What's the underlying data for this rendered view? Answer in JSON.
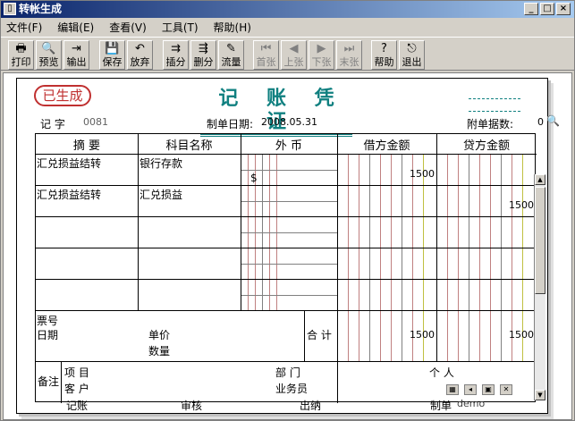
{
  "window": {
    "title": "转帐生成",
    "icon": "voucher-app-icon"
  },
  "title_buttons": [
    {
      "name": "minimize",
      "glyph": "_"
    },
    {
      "name": "maximize",
      "glyph": "□"
    },
    {
      "name": "close",
      "glyph": "×"
    }
  ],
  "menu": [
    {
      "label": "文件(F)"
    },
    {
      "label": "编辑(E)"
    },
    {
      "label": "查看(V)"
    },
    {
      "label": "工具(T)"
    },
    {
      "label": "帮助(H)"
    }
  ],
  "toolbar": [
    {
      "label": "打印",
      "icon": "printer-icon",
      "glyph": "🖶",
      "enabled": true
    },
    {
      "label": "预览",
      "icon": "preview-icon",
      "glyph": "🔍",
      "enabled": true
    },
    {
      "label": "输出",
      "icon": "export-icon",
      "glyph": "⇥",
      "enabled": true
    },
    {
      "label": "保存",
      "icon": "save-icon",
      "glyph": "💾",
      "enabled": true
    },
    {
      "label": "放弃",
      "icon": "undo-icon",
      "glyph": "↶",
      "enabled": true
    },
    {
      "label": "插分",
      "icon": "insert-row-icon",
      "glyph": "⇉",
      "enabled": true
    },
    {
      "label": "删分",
      "icon": "delete-row-icon",
      "glyph": "⇶",
      "enabled": true
    },
    {
      "label": "流量",
      "icon": "cashflow-icon",
      "glyph": "✎",
      "enabled": true
    },
    {
      "label": "首张",
      "icon": "first-icon",
      "glyph": "⏮",
      "enabled": false
    },
    {
      "label": "上张",
      "icon": "prev-icon",
      "glyph": "◀",
      "enabled": false
    },
    {
      "label": "下张",
      "icon": "next-icon",
      "glyph": "▶",
      "enabled": false
    },
    {
      "label": "末张",
      "icon": "last-icon",
      "glyph": "⏭",
      "enabled": false
    },
    {
      "label": "帮助",
      "icon": "help-icon",
      "glyph": "?",
      "enabled": true
    },
    {
      "label": "退出",
      "icon": "exit-icon",
      "glyph": "⎋",
      "enabled": true
    }
  ],
  "voucher": {
    "stamp": "已生成",
    "title": "记 账 凭 证",
    "type_label": "记 字",
    "number": "0081",
    "date_label": "制单日期:",
    "date": "2008.05.31",
    "attach_label": "附单据数:",
    "attach_count": "0",
    "headers": {
      "summary": "摘 要",
      "account": "科目名称",
      "foreign": "外 币",
      "debit": "借方金额",
      "credit": "贷方金额"
    },
    "rows": [
      {
        "summary": "汇兑损益结转",
        "account": "银行存款",
        "foreign": "$",
        "debit": "1500",
        "credit": ""
      },
      {
        "summary": "汇兑损益结转",
        "account": "汇兑损益",
        "foreign": "",
        "debit": "",
        "credit": "1500"
      }
    ],
    "ticket_label": "票号",
    "date_field_label": "日期",
    "unit_price_label": "单价",
    "qty_label": "数量",
    "total_label": "合 计",
    "total_debit": "1500",
    "total_credit": "1500",
    "remark_label": "备注",
    "project_label": "项  目",
    "dept_label": "部  门",
    "person_label": "个  人",
    "customer_label": "客  户",
    "salesman_label": "业务员",
    "signatures": {
      "booked": "记账",
      "review": "审核",
      "cashier": "出纳",
      "maker": "制单",
      "maker_name": "demo"
    }
  }
}
